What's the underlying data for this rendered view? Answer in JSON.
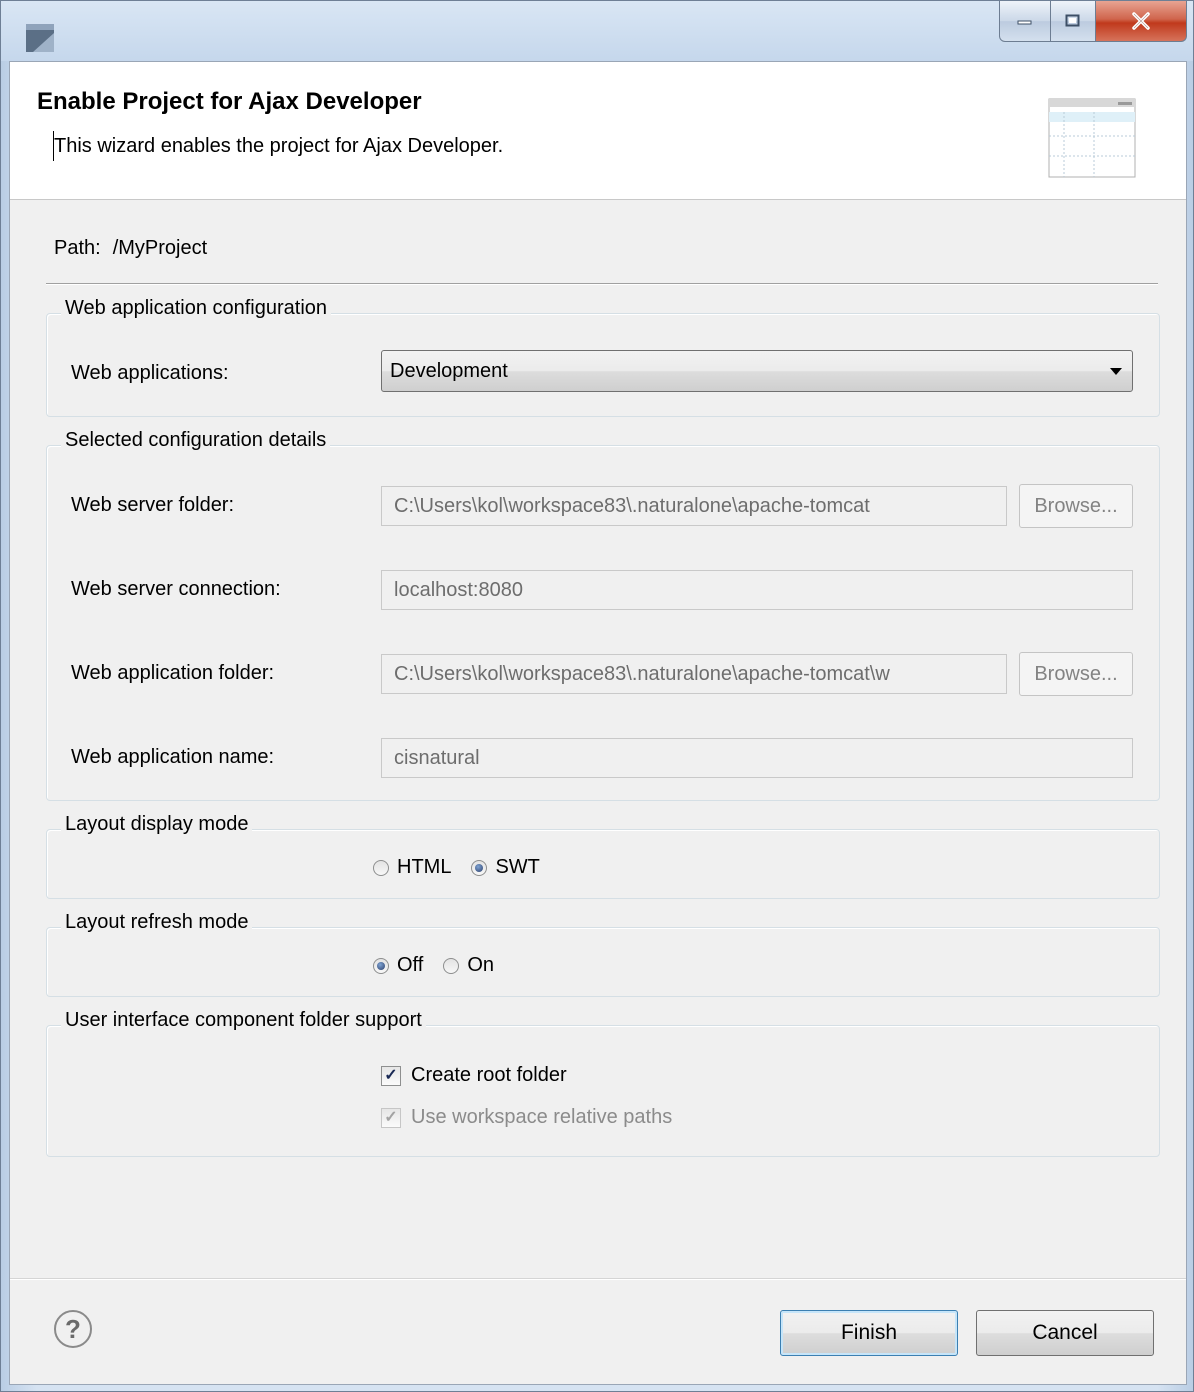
{
  "window": {
    "title": "",
    "controls": [
      "minimize-icon",
      "maximize-icon",
      "close-icon"
    ]
  },
  "banner": {
    "title": "Enable Project for Ajax Developer",
    "description": "This wizard enables the project for Ajax Developer."
  },
  "path": {
    "label": "Path:",
    "value": "/MyProject"
  },
  "web_app_config": {
    "group_label": "Web application configuration",
    "web_apps_label": "Web applications:",
    "web_apps_value": "Development"
  },
  "details": {
    "group_label": "Selected configuration details",
    "server_folder_label": "Web server folder:",
    "server_folder_value": "C:\\Users\\kol\\workspace83\\.naturalone\\apache-tomcat",
    "server_connection_label": "Web server connection:",
    "server_connection_value": "localhost:8080",
    "app_folder_label": "Web application folder:",
    "app_folder_value": "C:\\Users\\kol\\workspace83\\.naturalone\\apache-tomcat\\w",
    "app_name_label": "Web application name:",
    "app_name_value": "cisnatural",
    "browse_label": "Browse..."
  },
  "layout_display": {
    "group_label": "Layout display mode",
    "options": [
      "HTML",
      "SWT"
    ],
    "selected": "SWT"
  },
  "layout_refresh": {
    "group_label": "Layout refresh mode",
    "options": [
      "Off",
      "On"
    ],
    "selected": "Off"
  },
  "ui_component": {
    "group_label": "User interface component folder support",
    "create_root_label": "Create root folder",
    "create_root_checked": true,
    "relative_paths_label": "Use workspace relative paths",
    "relative_paths_checked": true,
    "relative_paths_enabled": false
  },
  "buttons": {
    "help": "?",
    "finish": "Finish",
    "cancel": "Cancel"
  }
}
